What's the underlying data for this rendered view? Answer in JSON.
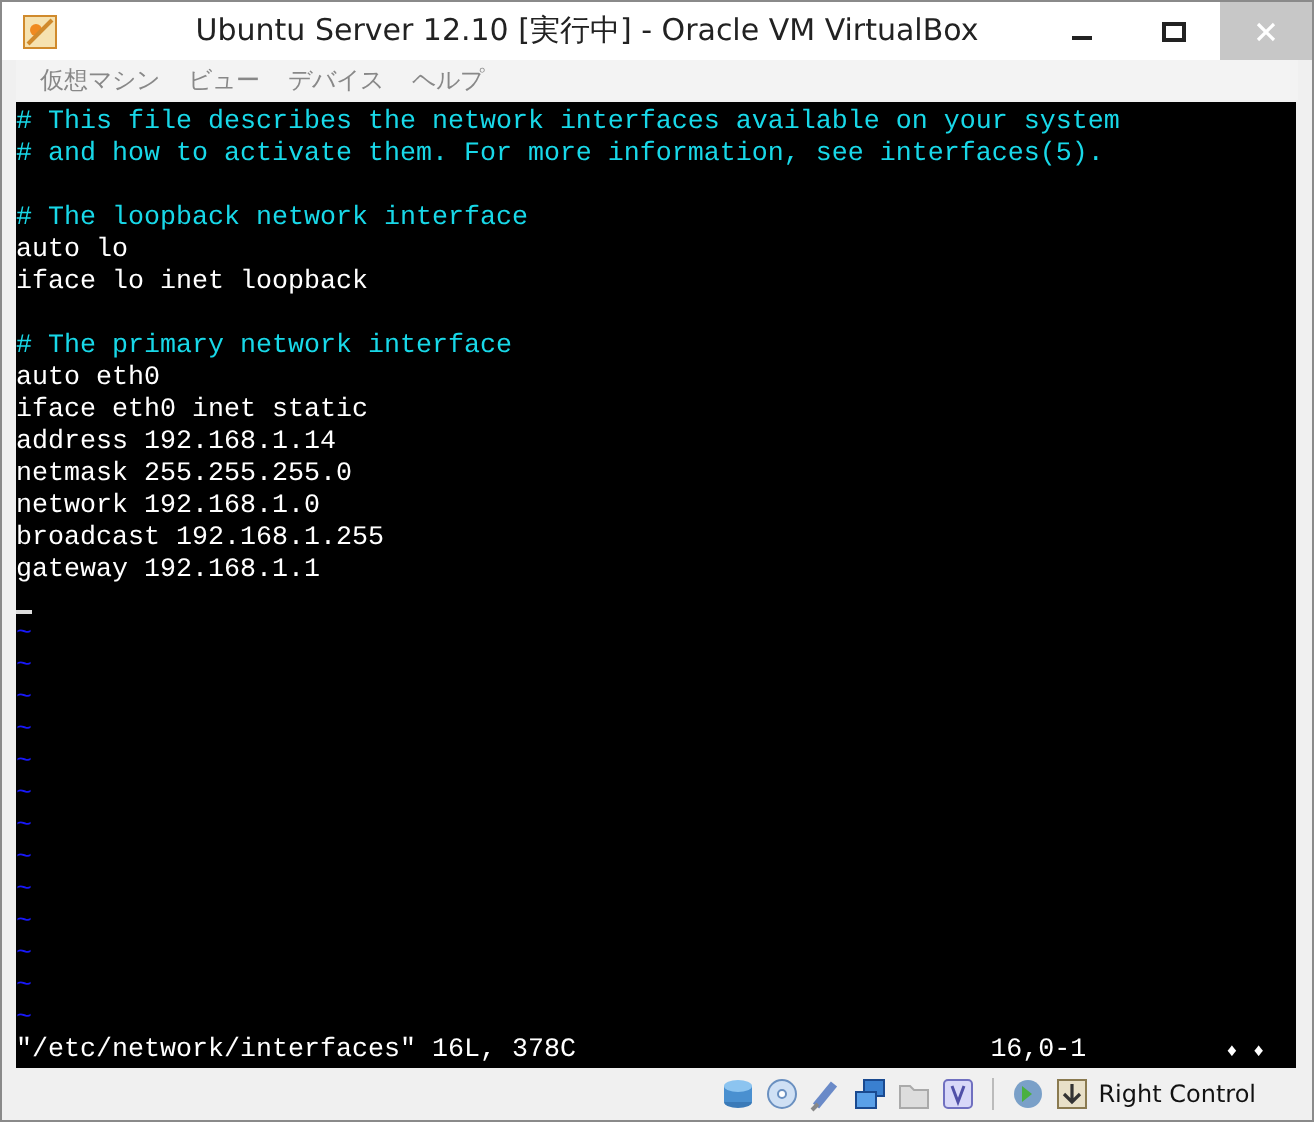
{
  "window": {
    "title": "Ubuntu Server 12.10 [実行中] - Oracle VM VirtualBox"
  },
  "menu": [
    "仮想マシン",
    "ビュー",
    "デバイス",
    "ヘルプ"
  ],
  "editor": {
    "lines": [
      {
        "kind": "comment",
        "text": "# This file describes the network interfaces available on your system"
      },
      {
        "kind": "comment",
        "text": "# and how to activate them. For more information, see interfaces(5)."
      },
      {
        "kind": "blank"
      },
      {
        "kind": "comment",
        "text": "# The loopback network interface"
      },
      {
        "kind": "text",
        "text": "auto lo"
      },
      {
        "kind": "text",
        "text": "iface lo inet loopback"
      },
      {
        "kind": "blank"
      },
      {
        "kind": "comment",
        "text": "# The primary network interface"
      },
      {
        "kind": "text",
        "text": "auto eth0"
      },
      {
        "kind": "text",
        "text": "iface eth0 inet static"
      },
      {
        "kind": "text",
        "text": "address 192.168.1.14"
      },
      {
        "kind": "text",
        "text": "netmask 255.255.255.0"
      },
      {
        "kind": "text",
        "text": "network 192.168.1.0"
      },
      {
        "kind": "text",
        "text": "broadcast 192.168.1.255"
      },
      {
        "kind": "text",
        "text": "gateway 192.168.1.1"
      },
      {
        "kind": "cursor"
      },
      {
        "kind": "tilde",
        "text": "~"
      },
      {
        "kind": "tilde",
        "text": "~"
      },
      {
        "kind": "tilde",
        "text": "~"
      },
      {
        "kind": "tilde",
        "text": "~"
      },
      {
        "kind": "tilde",
        "text": "~"
      },
      {
        "kind": "tilde",
        "text": "~"
      },
      {
        "kind": "tilde",
        "text": "~"
      },
      {
        "kind": "tilde",
        "text": "~"
      },
      {
        "kind": "tilde",
        "text": "~"
      },
      {
        "kind": "tilde",
        "text": "~"
      },
      {
        "kind": "tilde",
        "text": "~"
      },
      {
        "kind": "tilde",
        "text": "~"
      },
      {
        "kind": "tilde",
        "text": "~"
      }
    ],
    "message": "\"/etc/network/interfaces\" 16L, 378C",
    "ruler": "16,0-1",
    "marks": [
      "♦",
      "♦"
    ]
  },
  "status_bar": {
    "host_key": "Right Control"
  }
}
